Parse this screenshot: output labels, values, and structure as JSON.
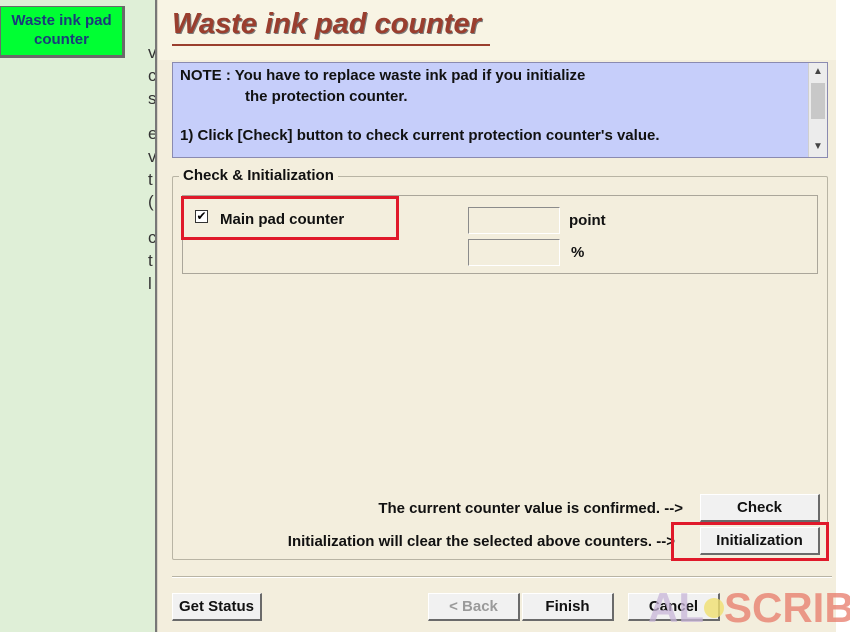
{
  "sidebar": {
    "active_item": "Waste ink pad counter"
  },
  "background_window": {
    "fragments": [
      "v",
      "c",
      "s",
      "e",
      "v",
      "t",
      "(",
      "c",
      "t",
      "l"
    ]
  },
  "dialog": {
    "title": "Waste ink pad counter",
    "note": {
      "line1": "NOTE : You have to replace waste ink pad if you initialize",
      "line2": "the protection counter.",
      "line3": "1) Click [Check] button to check current protection counter's value."
    },
    "group": {
      "legend": "Check & Initialization",
      "counter": {
        "label": "Main pad counter",
        "checked": true,
        "point_value": "",
        "percent_value": ""
      },
      "units": {
        "point": "point",
        "percent": "%"
      }
    },
    "actions": {
      "check_text": "The current counter value is confirmed. -->",
      "check_button": "Check",
      "init_text": "Initialization will clear the selected above counters. -->",
      "init_button": "Initialization"
    },
    "footer": {
      "get_status": "Get Status",
      "back": "< Back",
      "finish": "Finish",
      "cancel": "Cancel"
    }
  },
  "colors": {
    "highlight": "#e0192a",
    "title": "#9a3e2e",
    "note_bg": "#c6cefa",
    "sidebar_active": "#00ff33",
    "dialog_bg": "#f3eedd"
  }
}
